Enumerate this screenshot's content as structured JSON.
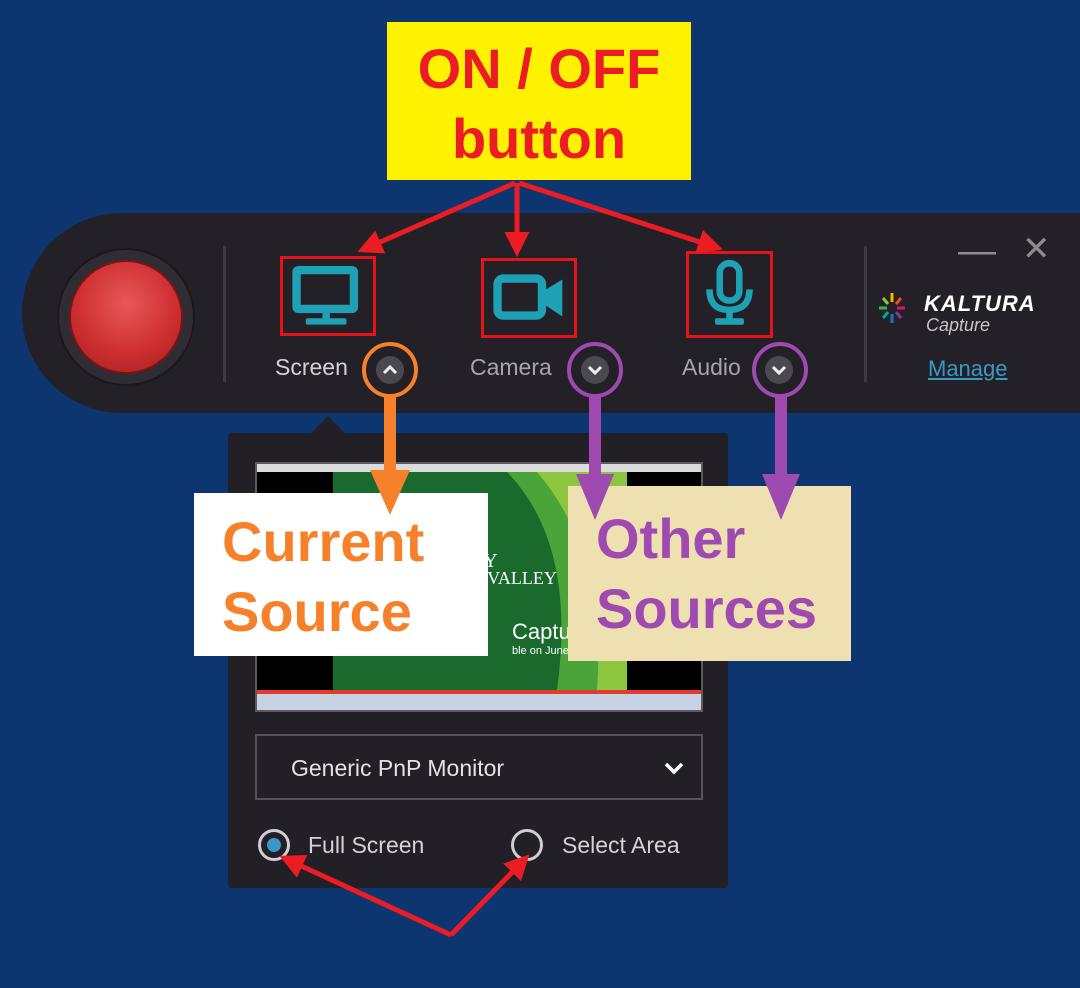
{
  "annotations": {
    "on_off": [
      "ON / OFF",
      "button"
    ],
    "current_source": [
      "Current",
      "Source"
    ],
    "other_sources": [
      "Other",
      "Sources"
    ]
  },
  "toolbar": {
    "sources": [
      {
        "label": "Screen",
        "icon": "monitor-icon",
        "chevron": "chevron-up-icon"
      },
      {
        "label": "Camera",
        "icon": "video-camera-icon",
        "chevron": "chevron-down-icon"
      },
      {
        "label": "Audio",
        "icon": "microphone-icon",
        "chevron": "chevron-down-icon"
      }
    ],
    "brand": {
      "name": "KALTURA",
      "product": "Capture"
    },
    "manage_label": "Manage",
    "minimize_glyph": "—",
    "close_glyph": "✕"
  },
  "panel": {
    "preview_overlay_text": {
      "line1": "TY",
      "line2": "R VALLEY",
      "line3": "Captu",
      "line4": "ble on June 30,"
    },
    "monitor_select": {
      "value": "Generic PnP Monitor"
    },
    "radio_options": [
      {
        "label": "Full Screen",
        "selected": true
      },
      {
        "label": "Select Area",
        "selected": false
      }
    ]
  },
  "colors": {
    "background": "#0d3670",
    "toolbar": "#232127",
    "record": "#cf2f31",
    "icon_teal": "#1ea1b5",
    "highlight_red": "#e5141b",
    "callout_yellow": "#fff200",
    "current_orange": "#f7812b",
    "other_purple": "#9f4ab0",
    "other_bg": "#efe0b2"
  }
}
